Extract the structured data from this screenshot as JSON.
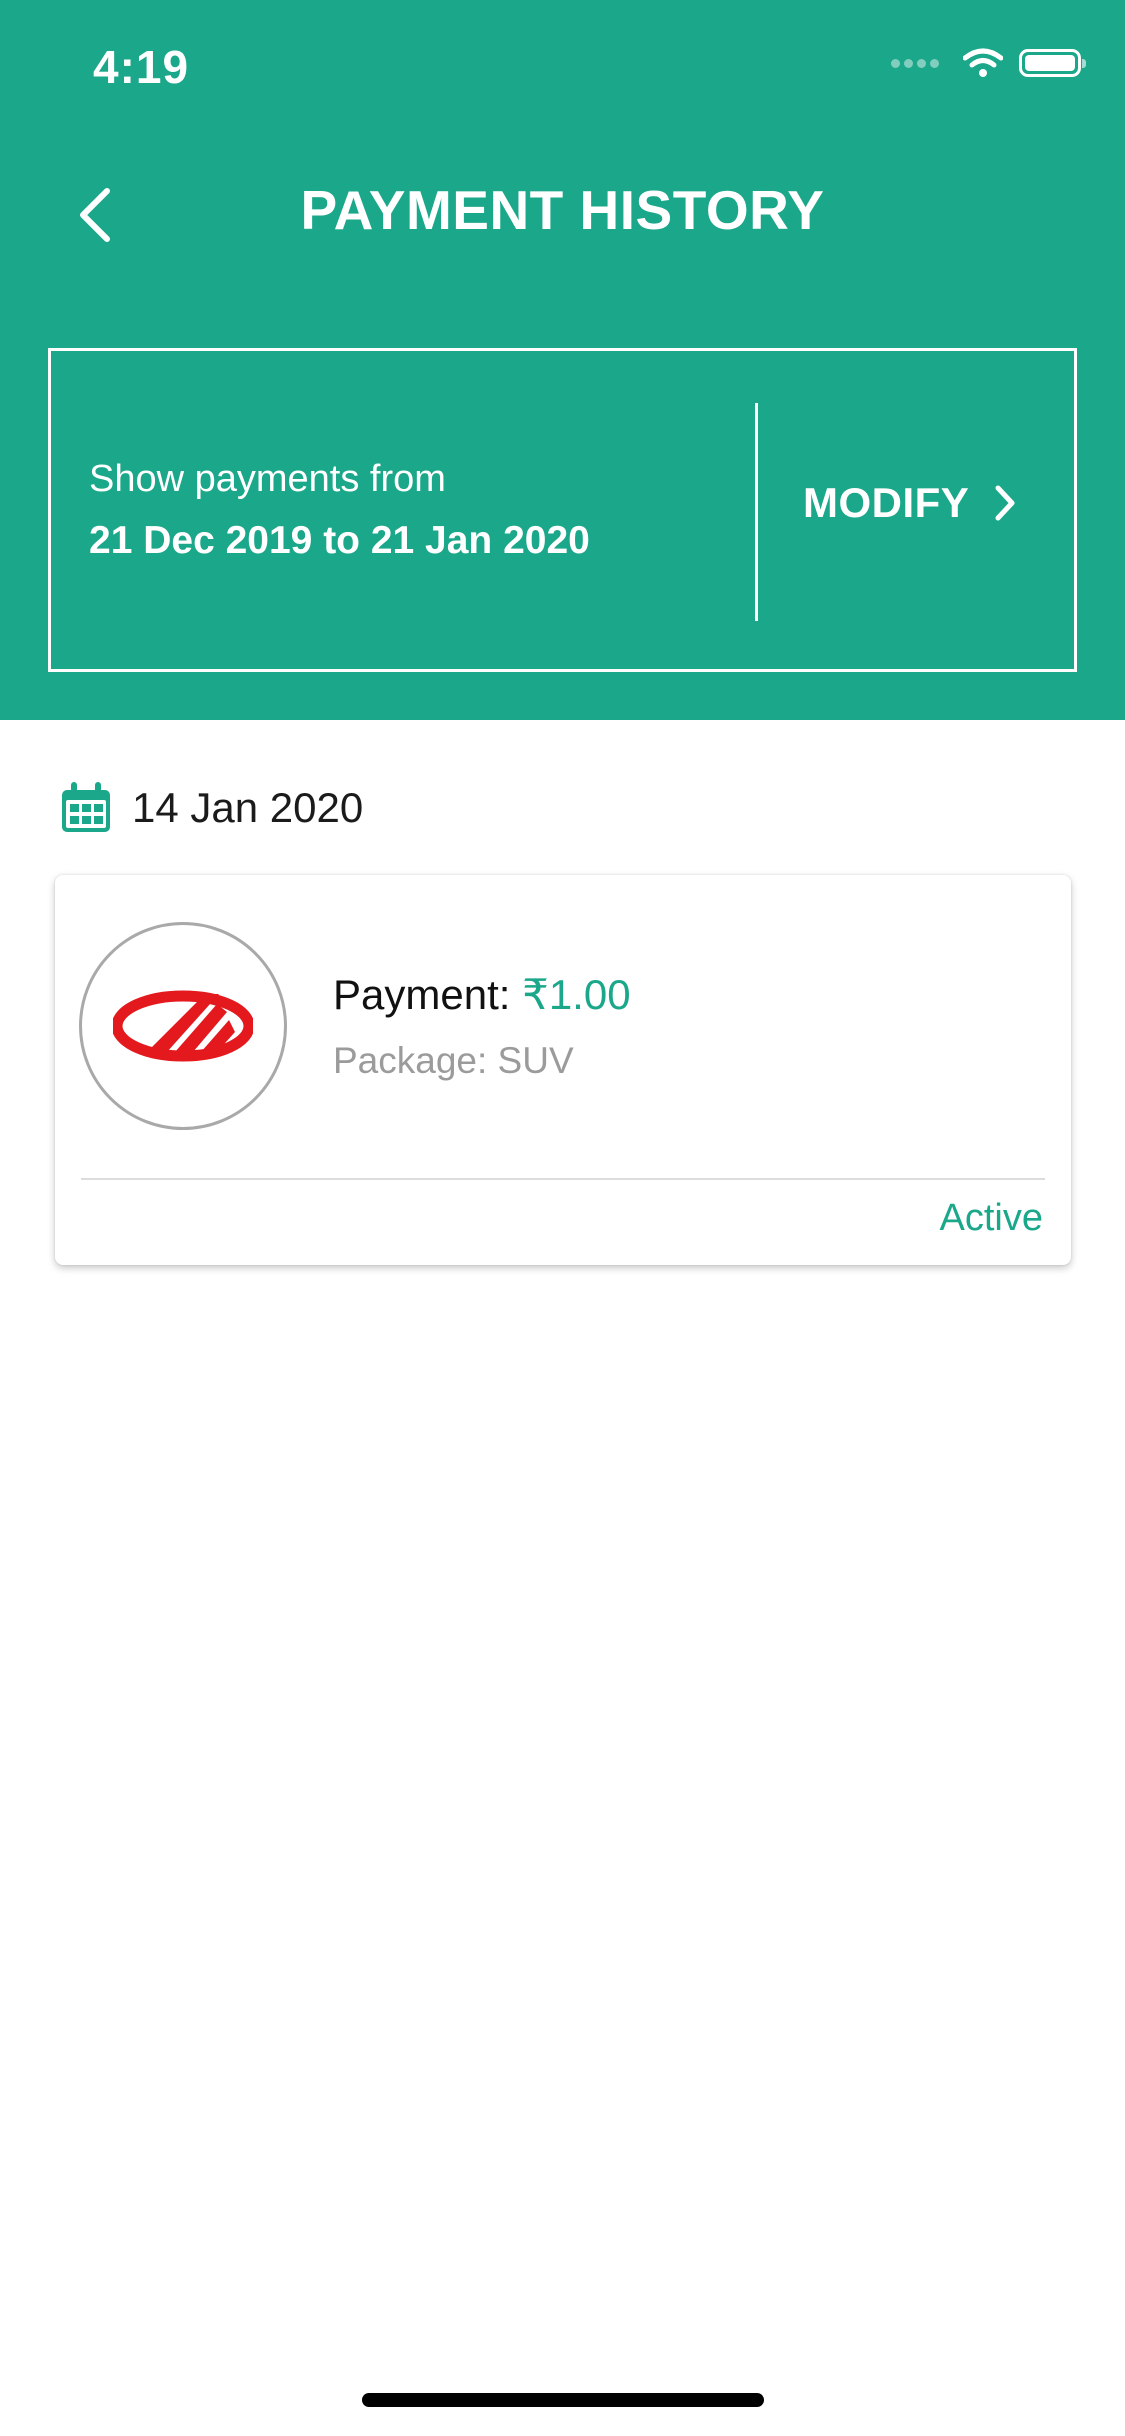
{
  "status_bar": {
    "time": "4:19"
  },
  "header": {
    "title": "PAYMENT HISTORY",
    "back_icon": "chevron-left-icon"
  },
  "filter": {
    "label": "Show payments from",
    "range": "21 Dec 2019 to 21 Jan 2020",
    "modify_label": "MODIFY"
  },
  "groups": [
    {
      "date": "14 Jan 2020",
      "date_icon": "calendar-icon",
      "items": [
        {
          "payment_label": "Payment:",
          "amount": "₹1.00",
          "package": "Package: SUV",
          "status": "Active",
          "logo_icon": "mahindra-logo-icon"
        }
      ]
    }
  ],
  "colors": {
    "brand": "#1aa78a",
    "logo": "#e3191e",
    "text_muted": "#9b9b9b"
  }
}
